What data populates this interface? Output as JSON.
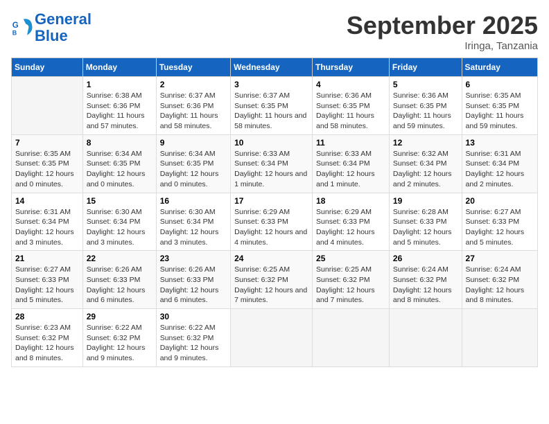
{
  "header": {
    "logo_line1": "General",
    "logo_line2": "Blue",
    "month": "September 2025",
    "location": "Iringa, Tanzania"
  },
  "days_of_week": [
    "Sunday",
    "Monday",
    "Tuesday",
    "Wednesday",
    "Thursday",
    "Friday",
    "Saturday"
  ],
  "weeks": [
    [
      {
        "day": "",
        "sunrise": "",
        "sunset": "",
        "daylight": ""
      },
      {
        "day": "1",
        "sunrise": "Sunrise: 6:38 AM",
        "sunset": "Sunset: 6:36 PM",
        "daylight": "Daylight: 11 hours and 57 minutes."
      },
      {
        "day": "2",
        "sunrise": "Sunrise: 6:37 AM",
        "sunset": "Sunset: 6:36 PM",
        "daylight": "Daylight: 11 hours and 58 minutes."
      },
      {
        "day": "3",
        "sunrise": "Sunrise: 6:37 AM",
        "sunset": "Sunset: 6:35 PM",
        "daylight": "Daylight: 11 hours and 58 minutes."
      },
      {
        "day": "4",
        "sunrise": "Sunrise: 6:36 AM",
        "sunset": "Sunset: 6:35 PM",
        "daylight": "Daylight: 11 hours and 58 minutes."
      },
      {
        "day": "5",
        "sunrise": "Sunrise: 6:36 AM",
        "sunset": "Sunset: 6:35 PM",
        "daylight": "Daylight: 11 hours and 59 minutes."
      },
      {
        "day": "6",
        "sunrise": "Sunrise: 6:35 AM",
        "sunset": "Sunset: 6:35 PM",
        "daylight": "Daylight: 11 hours and 59 minutes."
      }
    ],
    [
      {
        "day": "7",
        "sunrise": "Sunrise: 6:35 AM",
        "sunset": "Sunset: 6:35 PM",
        "daylight": "Daylight: 12 hours and 0 minutes."
      },
      {
        "day": "8",
        "sunrise": "Sunrise: 6:34 AM",
        "sunset": "Sunset: 6:35 PM",
        "daylight": "Daylight: 12 hours and 0 minutes."
      },
      {
        "day": "9",
        "sunrise": "Sunrise: 6:34 AM",
        "sunset": "Sunset: 6:35 PM",
        "daylight": "Daylight: 12 hours and 0 minutes."
      },
      {
        "day": "10",
        "sunrise": "Sunrise: 6:33 AM",
        "sunset": "Sunset: 6:34 PM",
        "daylight": "Daylight: 12 hours and 1 minute."
      },
      {
        "day": "11",
        "sunrise": "Sunrise: 6:33 AM",
        "sunset": "Sunset: 6:34 PM",
        "daylight": "Daylight: 12 hours and 1 minute."
      },
      {
        "day": "12",
        "sunrise": "Sunrise: 6:32 AM",
        "sunset": "Sunset: 6:34 PM",
        "daylight": "Daylight: 12 hours and 2 minutes."
      },
      {
        "day": "13",
        "sunrise": "Sunrise: 6:31 AM",
        "sunset": "Sunset: 6:34 PM",
        "daylight": "Daylight: 12 hours and 2 minutes."
      }
    ],
    [
      {
        "day": "14",
        "sunrise": "Sunrise: 6:31 AM",
        "sunset": "Sunset: 6:34 PM",
        "daylight": "Daylight: 12 hours and 3 minutes."
      },
      {
        "day": "15",
        "sunrise": "Sunrise: 6:30 AM",
        "sunset": "Sunset: 6:34 PM",
        "daylight": "Daylight: 12 hours and 3 minutes."
      },
      {
        "day": "16",
        "sunrise": "Sunrise: 6:30 AM",
        "sunset": "Sunset: 6:34 PM",
        "daylight": "Daylight: 12 hours and 3 minutes."
      },
      {
        "day": "17",
        "sunrise": "Sunrise: 6:29 AM",
        "sunset": "Sunset: 6:33 PM",
        "daylight": "Daylight: 12 hours and 4 minutes."
      },
      {
        "day": "18",
        "sunrise": "Sunrise: 6:29 AM",
        "sunset": "Sunset: 6:33 PM",
        "daylight": "Daylight: 12 hours and 4 minutes."
      },
      {
        "day": "19",
        "sunrise": "Sunrise: 6:28 AM",
        "sunset": "Sunset: 6:33 PM",
        "daylight": "Daylight: 12 hours and 5 minutes."
      },
      {
        "day": "20",
        "sunrise": "Sunrise: 6:27 AM",
        "sunset": "Sunset: 6:33 PM",
        "daylight": "Daylight: 12 hours and 5 minutes."
      }
    ],
    [
      {
        "day": "21",
        "sunrise": "Sunrise: 6:27 AM",
        "sunset": "Sunset: 6:33 PM",
        "daylight": "Daylight: 12 hours and 5 minutes."
      },
      {
        "day": "22",
        "sunrise": "Sunrise: 6:26 AM",
        "sunset": "Sunset: 6:33 PM",
        "daylight": "Daylight: 12 hours and 6 minutes."
      },
      {
        "day": "23",
        "sunrise": "Sunrise: 6:26 AM",
        "sunset": "Sunset: 6:33 PM",
        "daylight": "Daylight: 12 hours and 6 minutes."
      },
      {
        "day": "24",
        "sunrise": "Sunrise: 6:25 AM",
        "sunset": "Sunset: 6:32 PM",
        "daylight": "Daylight: 12 hours and 7 minutes."
      },
      {
        "day": "25",
        "sunrise": "Sunrise: 6:25 AM",
        "sunset": "Sunset: 6:32 PM",
        "daylight": "Daylight: 12 hours and 7 minutes."
      },
      {
        "day": "26",
        "sunrise": "Sunrise: 6:24 AM",
        "sunset": "Sunset: 6:32 PM",
        "daylight": "Daylight: 12 hours and 8 minutes."
      },
      {
        "day": "27",
        "sunrise": "Sunrise: 6:24 AM",
        "sunset": "Sunset: 6:32 PM",
        "daylight": "Daylight: 12 hours and 8 minutes."
      }
    ],
    [
      {
        "day": "28",
        "sunrise": "Sunrise: 6:23 AM",
        "sunset": "Sunset: 6:32 PM",
        "daylight": "Daylight: 12 hours and 8 minutes."
      },
      {
        "day": "29",
        "sunrise": "Sunrise: 6:22 AM",
        "sunset": "Sunset: 6:32 PM",
        "daylight": "Daylight: 12 hours and 9 minutes."
      },
      {
        "day": "30",
        "sunrise": "Sunrise: 6:22 AM",
        "sunset": "Sunset: 6:32 PM",
        "daylight": "Daylight: 12 hours and 9 minutes."
      },
      {
        "day": "",
        "sunrise": "",
        "sunset": "",
        "daylight": ""
      },
      {
        "day": "",
        "sunrise": "",
        "sunset": "",
        "daylight": ""
      },
      {
        "day": "",
        "sunrise": "",
        "sunset": "",
        "daylight": ""
      },
      {
        "day": "",
        "sunrise": "",
        "sunset": "",
        "daylight": ""
      }
    ]
  ]
}
